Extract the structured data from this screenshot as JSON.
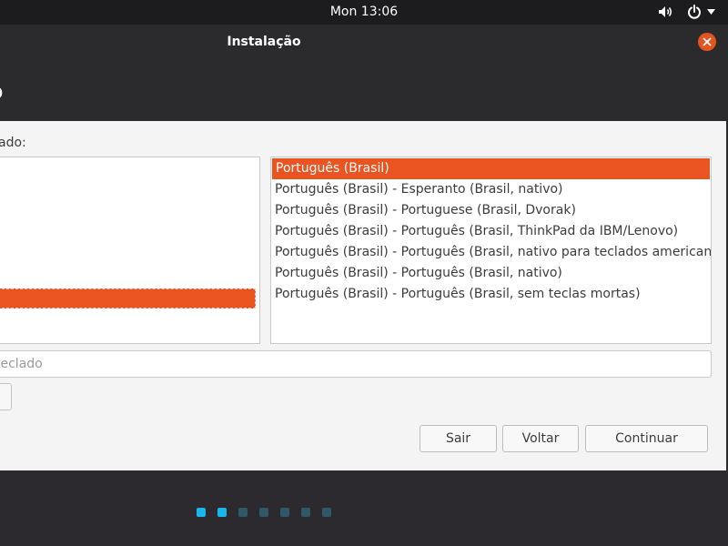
{
  "topbar": {
    "clock": "Mon 13:06",
    "icons": [
      "volume-icon",
      "power-icon",
      "chevron-down-icon"
    ]
  },
  "window": {
    "title": "Instalação",
    "heading": "o",
    "close_icon": "close-icon"
  },
  "layout_panel": {
    "label": "ado:",
    "selected_index": 6
  },
  "variants": {
    "items": [
      "Português (Brasil)",
      "Português (Brasil) - Esperanto (Brasil, nativo)",
      "Português (Brasil) - Portuguese (Brasil, Dvorak)",
      "Português (Brasil) - Português (Brasil, ThinkPad da IBM/Lenovo)",
      "Português (Brasil) - Português (Brasil, nativo para teclados americanos)",
      "Português (Brasil) - Português (Brasil, nativo)",
      "Português (Brasil) - Português (Brasil, sem teclas mortas)"
    ],
    "selected_index": 0
  },
  "test_input": {
    "placeholder": "teclado",
    "value": ""
  },
  "buttons": {
    "quit": "Sair",
    "back": "Voltar",
    "continue": "Continuar"
  },
  "progress": {
    "total_steps": 7,
    "completed_steps": 2
  },
  "colors": {
    "accent": "#e95420",
    "dot_active": "#19b6ee",
    "dot_inactive": "#2f5966"
  }
}
